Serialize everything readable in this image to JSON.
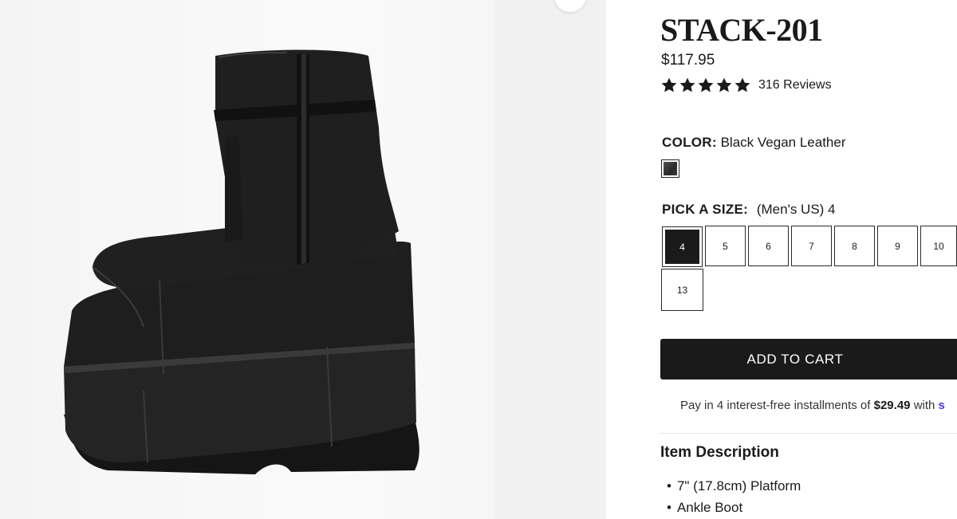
{
  "product": {
    "title": "STACK-201",
    "price": "$117.95",
    "rating_value": 5,
    "reviews_label": "316 Reviews"
  },
  "color": {
    "label": "COLOR:",
    "selected": "Black Vegan Leather",
    "swatch_color": "#2f2f2f"
  },
  "size": {
    "label": "PICK A SIZE:",
    "selected_text": "(Men's US) 4",
    "options": [
      "4",
      "5",
      "6",
      "7",
      "8",
      "9",
      "10",
      "13"
    ],
    "selected": "4"
  },
  "cart": {
    "add_label": "ADD TO CART"
  },
  "installments": {
    "prefix": "Pay in 4 interest-free installments of",
    "amount": "$29.49",
    "suffix": "with",
    "brand": "s"
  },
  "description": {
    "title": "Item Description",
    "items": [
      "7\" (17.8cm) Platform",
      "Ankle Boot"
    ]
  },
  "icons": {
    "rating": "star-icon",
    "carousel": "carousel-nav-icon"
  },
  "colors": {
    "primary": "#1a1a1a",
    "image_background": "#f2f2f2",
    "shop_pay": "#5a31f4"
  }
}
